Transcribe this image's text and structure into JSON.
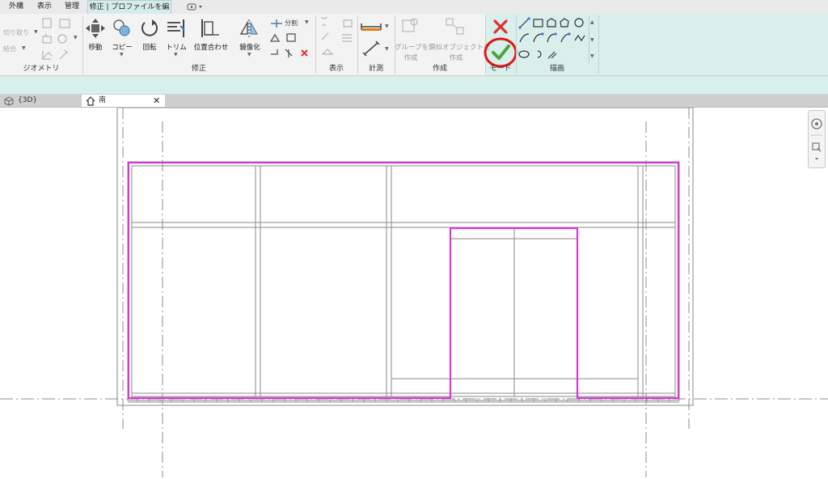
{
  "menu_tabs": [
    {
      "label": "外構"
    },
    {
      "label": "表示"
    },
    {
      "label": "管理"
    },
    {
      "label": "修正 | プロファイルを編集"
    }
  ],
  "ribbon": {
    "geometry": {
      "label": "ジオメトリ",
      "cut_label": "切り取り",
      "join_label": "結合"
    },
    "modify": {
      "label": "修正",
      "move": "移動",
      "copy": "コピー",
      "rotate": "回転",
      "trim": "トリム",
      "align": "位置合わせ",
      "mirror": "鏡像化",
      "split": "分割"
    },
    "view_panel": {
      "label": "表示"
    },
    "measure_panel": {
      "label": "計測"
    },
    "create": {
      "label": "作成",
      "group_line1": "グループを",
      "group_line2": "作成",
      "similar_line1": "類似オブジェクトを",
      "similar_line2": "作成"
    },
    "mode": {
      "label": "モード"
    },
    "draw": {
      "label": "描画"
    }
  },
  "view_tabs": [
    {
      "label": "{3D}"
    },
    {
      "label": "南"
    }
  ],
  "colors": {
    "accent_teal": "#d9efec",
    "profile_magenta": "#d43bd4",
    "finish_green": "#4aa53a",
    "cancel_red": "#e03030",
    "highlight_circle": "#e01515"
  }
}
